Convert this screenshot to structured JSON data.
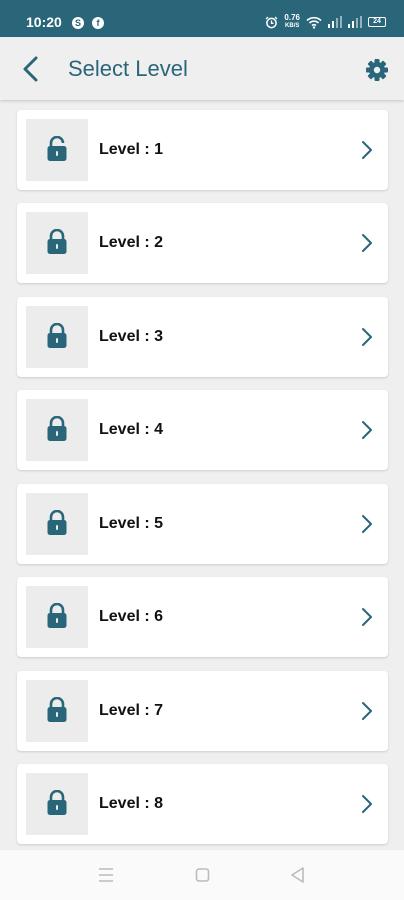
{
  "status_bar": {
    "time": "10:20",
    "speed_value": "0.76",
    "speed_unit": "KB/S",
    "battery": "24",
    "app_icons": [
      "skype-icon",
      "facebook-icon"
    ]
  },
  "header": {
    "title": "Select Level",
    "back_icon": "chevron-left-icon",
    "settings_icon": "gear-icon"
  },
  "levels": [
    {
      "label": "Level : 1",
      "locked": true
    },
    {
      "label": "Level : 2",
      "locked": true
    },
    {
      "label": "Level : 3",
      "locked": true
    },
    {
      "label": "Level : 4",
      "locked": true
    },
    {
      "label": "Level : 5",
      "locked": true
    },
    {
      "label": "Level : 6",
      "locked": true
    },
    {
      "label": "Level : 7",
      "locked": true
    },
    {
      "label": "Level : 8",
      "locked": true
    }
  ],
  "nav_bar": {
    "icons": [
      "menu-icon",
      "home-square-icon",
      "back-triangle-icon"
    ]
  },
  "colors": {
    "accent": "#2a6679",
    "background": "#efefef",
    "card": "#ffffff"
  }
}
